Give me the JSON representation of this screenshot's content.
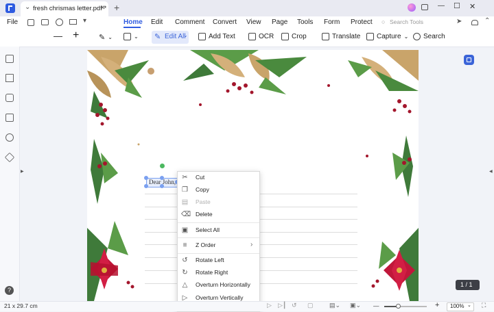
{
  "window": {
    "tab_title": "fresh chrismas letter.pdf *",
    "new_tab": "+",
    "controls": {
      "minimize": "—",
      "maximize": "☐",
      "close": "✕"
    }
  },
  "menubar": {
    "file": "File",
    "tabs": [
      "Home",
      "Edit",
      "Comment",
      "Convert",
      "View",
      "Page",
      "Tools",
      "Form",
      "Protect"
    ],
    "active_tab": "Home",
    "search_placeholder": "Search Tools"
  },
  "toolbar": {
    "zoom_out": "—",
    "zoom_in": "+",
    "edit_all": "Edit All",
    "add_text": "Add Text",
    "ocr": "OCR",
    "crop": "Crop",
    "translate": "Translate",
    "capture": "Capture",
    "search": "Search"
  },
  "document": {
    "selected_text": "Dear John,"
  },
  "context_menu": {
    "items": [
      {
        "label": "Cut",
        "icon": "scissors-icon",
        "enabled": true
      },
      {
        "label": "Copy",
        "icon": "copy-icon",
        "enabled": true
      },
      {
        "label": "Paste",
        "icon": "paste-icon",
        "enabled": false
      },
      {
        "label": "Delete",
        "icon": "trash-icon",
        "enabled": true
      },
      {
        "label": "Select All",
        "icon": "select-all-icon",
        "enabled": true
      },
      {
        "label": "Z Order",
        "icon": "z-order-icon",
        "enabled": true,
        "submenu": "›"
      },
      {
        "label": "Rotate Left",
        "icon": "rotate-left-icon",
        "enabled": true
      },
      {
        "label": "Rotate Right",
        "icon": "rotate-right-icon",
        "enabled": true
      },
      {
        "label": "Overturn Horizontally",
        "icon": "flip-horizontal-icon",
        "enabled": true
      },
      {
        "label": "Overturn Vertically",
        "icon": "flip-vertical-icon",
        "enabled": true
      }
    ]
  },
  "page_indicator": "1 / 1",
  "status": {
    "page_size": "21 x 29.7 cm",
    "zoom_level": 0.32,
    "zoom_percent": "100%",
    "zoom_minus": "—",
    "zoom_plus": "+"
  },
  "colors": {
    "accent": "#3b64d8",
    "gold": "#c9a46a",
    "green": "#3f7a3a",
    "berry": "#a3162c",
    "poinsettia": "#c0173a"
  }
}
